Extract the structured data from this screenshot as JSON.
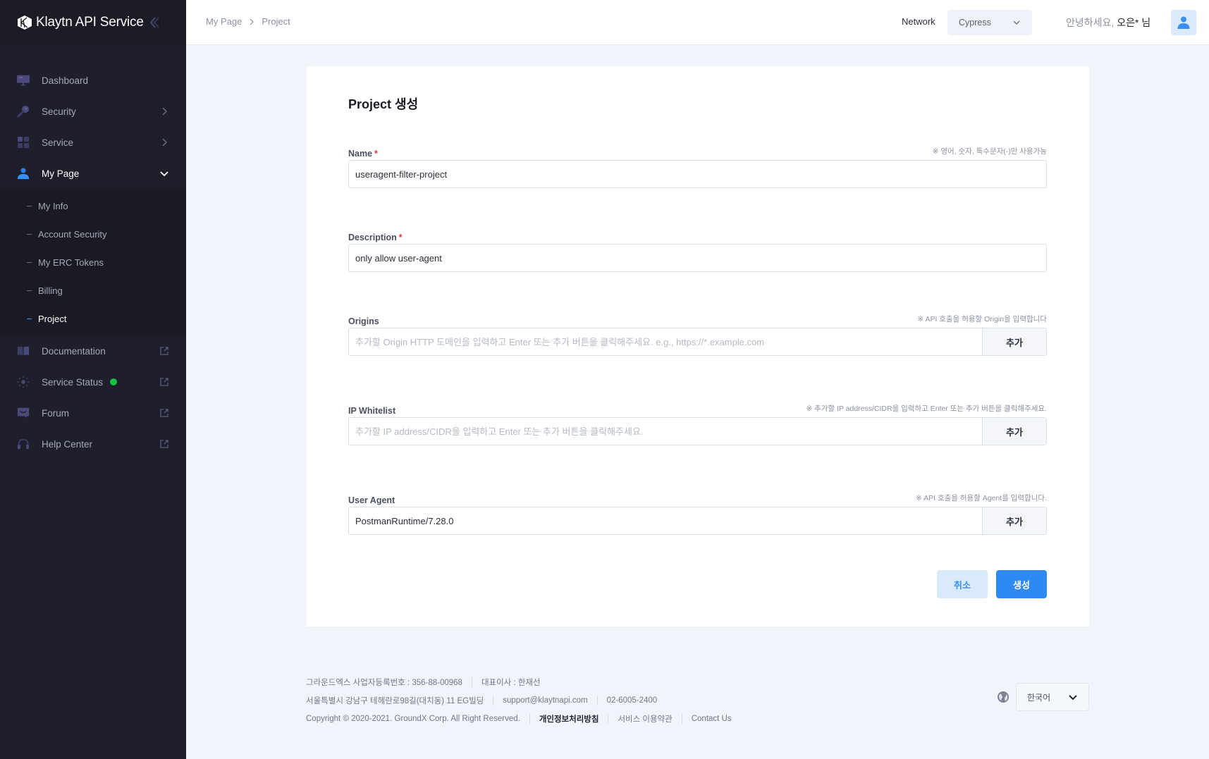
{
  "app": {
    "title": "Klaytn API Service"
  },
  "sidebar": {
    "items": [
      {
        "label": "Dashboard"
      },
      {
        "label": "Security"
      },
      {
        "label": "Service"
      },
      {
        "label": "My Page"
      },
      {
        "label": "Documentation"
      },
      {
        "label": "Service Status"
      },
      {
        "label": "Forum"
      },
      {
        "label": "Help Center"
      }
    ],
    "my_page_sub": [
      {
        "label": "My Info"
      },
      {
        "label": "Account Security"
      },
      {
        "label": "My ERC Tokens"
      },
      {
        "label": "Billing"
      },
      {
        "label": "Project"
      }
    ],
    "status_color": "#13c241"
  },
  "topbar": {
    "breadcrumb": [
      "My Page",
      "Project"
    ],
    "network_label": "Network",
    "network_value": "Cypress",
    "greeting_prefix": "안녕하세요, ",
    "user_name": "오은* 님"
  },
  "form": {
    "title": "Project 생성",
    "name": {
      "label": "Name",
      "required": "*",
      "hint": "※ 영어, 숫자, 특수문자(-)만 사용가능",
      "value": "useragent-filter-project"
    },
    "description": {
      "label": "Description",
      "required": "*",
      "value": "only allow user-agent"
    },
    "origins": {
      "label": "Origins",
      "hint": "※ API 호출을 허용할 Origin을 입력합니다",
      "placeholder": "추가할 Origin HTTP 도메인을 입력하고 Enter 또는 추가 버튼을 클릭해주세요. e.g., https://*.example.com",
      "add_label": "추가"
    },
    "ip_whitelist": {
      "label": "IP Whitelist",
      "hint": "※ 추가할 IP address/CIDR을 입력하고 Enter 또는 추가 버튼을 클릭해주세요.",
      "placeholder": "추가할 IP address/CIDR을 입력하고 Enter 또는 추가 버튼을 클릭해주세요.",
      "add_label": "추가"
    },
    "user_agent": {
      "label": "User Agent",
      "hint": "※ API 호출을 허용할 Agent를 입력합니다.",
      "value": "PostmanRuntime/7.28.0",
      "add_label": "추가"
    },
    "cancel_label": "취소",
    "create_label": "생성",
    "accent_color": "#2e8af2"
  },
  "footer": {
    "company": "그라운드엑스 사업자등록번호 : 356-88-00968",
    "ceo": "대표이사 : 한재선",
    "address": "서울특별시 강남구 테헤란로98길(대치동) 11 EG빌딩",
    "email": "support@klaytnapi.com",
    "phone": "02-6005-2400",
    "copyright": "Copyright © 2020-2021. GroundX Corp. All Right Reserved.",
    "privacy": "개인정보처리방침",
    "terms": "서비스 이용약관",
    "contact": "Contact Us",
    "language": "한국어"
  }
}
